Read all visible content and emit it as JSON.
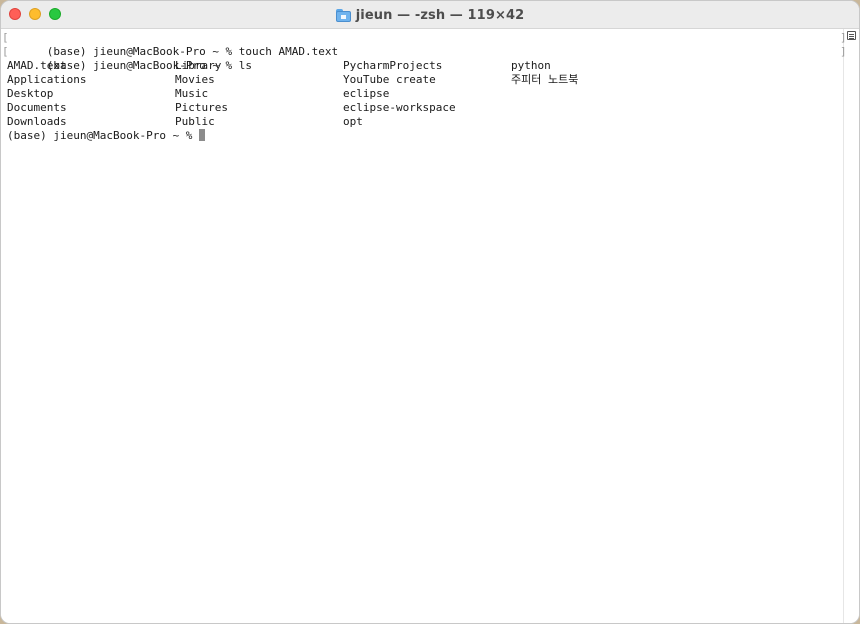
{
  "window": {
    "title": "jieun — -zsh — 119×42"
  },
  "terminal": {
    "history": [
      {
        "text": "(base) jieun@MacBook-Pro ~ % touch AMAD.text",
        "marked": true
      },
      {
        "text": "(base) jieun@MacBook-Pro ~ % ls",
        "marked": true
      }
    ],
    "ls_output": [
      [
        "AMAD.text",
        "Library",
        "PycharmProjects",
        "python"
      ],
      [
        "Applications",
        "Movies",
        "YouTube create",
        "주피터 노트북"
      ],
      [
        "Desktop",
        "Music",
        "eclipse",
        ""
      ],
      [
        "Documents",
        "Pictures",
        "eclipse-workspace",
        ""
      ],
      [
        "Downloads",
        "Public",
        "opt",
        ""
      ]
    ],
    "prompt": "(base) jieun@MacBook-Pro ~ % "
  },
  "icons": {
    "folder": "home-folder-icon",
    "marks": "marks-toggle-icon"
  },
  "colors": {
    "close": "#ff5f57",
    "minimize": "#febc2e",
    "zoom": "#28c840",
    "cursor": "#8c8c8c"
  }
}
